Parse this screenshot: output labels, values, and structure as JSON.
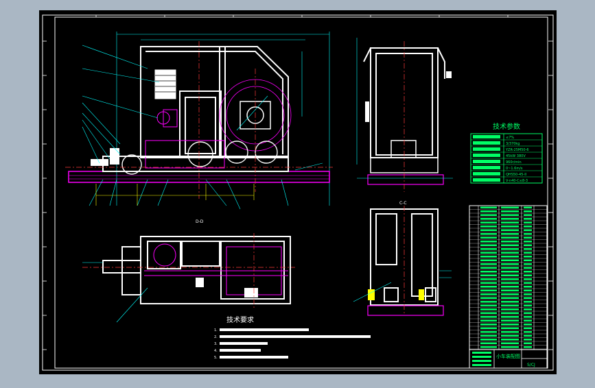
{
  "colors": {
    "background": "#aab7c4",
    "sheet": "#000000",
    "frame": "#ffffff",
    "part_outline": "#ffffff",
    "hidden_lines": "#ff00ff",
    "leader_lines": "#00ffff",
    "centerline": "#ff3b3b",
    "table_text": "#00ff66",
    "dimension": "#ffff00"
  },
  "views": {
    "top_view_label": "D-D",
    "section_label": "C-C"
  },
  "tech_params": {
    "title": "技术参数",
    "rows": [
      {
        "label": "",
        "value": "≤7%"
      },
      {
        "label": "",
        "value": "3/370kg"
      },
      {
        "label": "",
        "value": "YZR-25M50-6"
      },
      {
        "label": "",
        "value": "45kW  380V"
      },
      {
        "label": "",
        "value": "960r/min"
      },
      {
        "label": "",
        "value": "0~1.6m/s"
      },
      {
        "label": "",
        "value": "QHS50-45-II"
      },
      {
        "label": "",
        "value": "V-n40-C≤8-3"
      }
    ]
  },
  "tech_requirements": {
    "title": "技术要求",
    "items": [
      "1.",
      "2.",
      "3.",
      "4.",
      "5."
    ]
  },
  "title_block": {
    "title": "小车装配图",
    "code": "S/CJ"
  }
}
